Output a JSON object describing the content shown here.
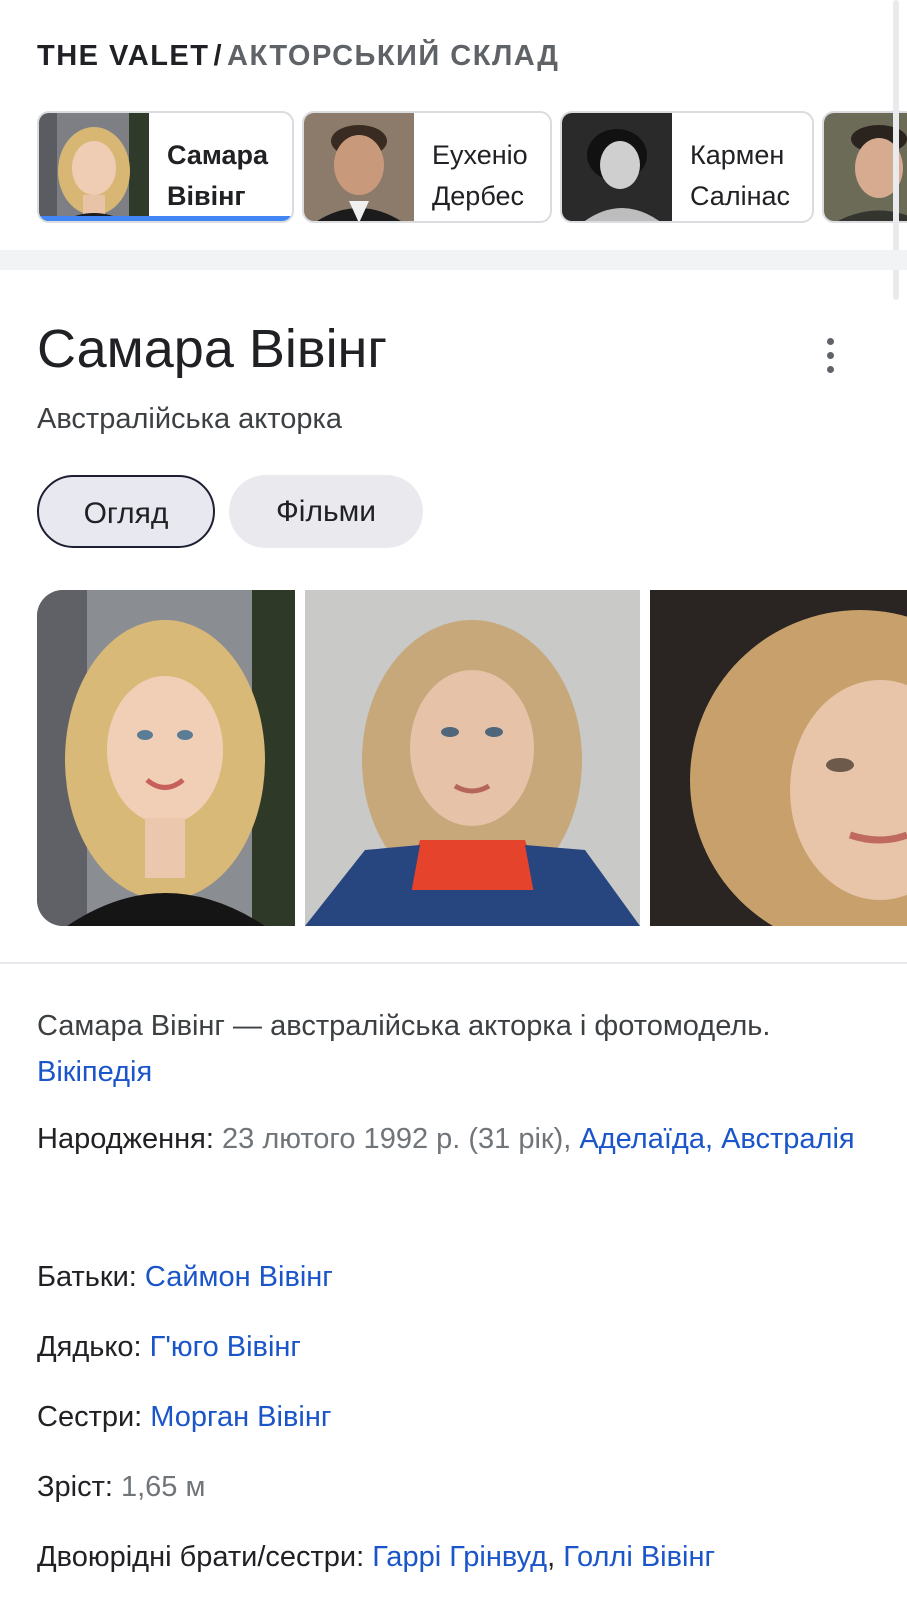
{
  "breadcrumb": {
    "show": "THE VALET",
    "separator": "/",
    "section": "АКТОРСЬКИЙ СКЛАД"
  },
  "cast": [
    {
      "name": "Самара\nВівінг",
      "active": true
    },
    {
      "name": "Еухеніо\nДербес",
      "active": false
    },
    {
      "name": "Кармен\nСалінас",
      "active": false
    },
    {
      "name": "",
      "active": false
    }
  ],
  "entity": {
    "title": "Самара Вівінг",
    "subtitle": "Австралійська акторка"
  },
  "tabs": [
    {
      "label": "Огляд",
      "selected": true
    },
    {
      "label": "Фільми",
      "selected": false
    }
  ],
  "description": {
    "text": "Самара Вівінг — австралійська акторка і фотомодель. ",
    "source_link": "Вікіпедія"
  },
  "facts": {
    "born": {
      "label": "Народження: ",
      "value": "23 лютого 1992 р. (31 рік), ",
      "link": "Аделаїда, Австралія"
    },
    "parents": {
      "label": "Батьки: ",
      "link": "Саймон Вівінг"
    },
    "uncle": {
      "label": "Дядько: ",
      "link": "Г'юго Вівінг"
    },
    "sisters": {
      "label": "Сестри: ",
      "link": "Морган Вівінг"
    },
    "height": {
      "label": "Зріст: ",
      "value": "1,65 м"
    },
    "cousins": {
      "label": "Двоюрідні брати/сестри: ",
      "link1": "Гаррі Грінвуд",
      "comma": ", ",
      "link2": "Голлі Вівінг"
    }
  },
  "colors": {
    "link": "#1a55c9",
    "active_indicator": "#4285f4",
    "text": "#202124",
    "muted": "#70757a"
  },
  "icons": {
    "more": "more-vert-icon"
  }
}
